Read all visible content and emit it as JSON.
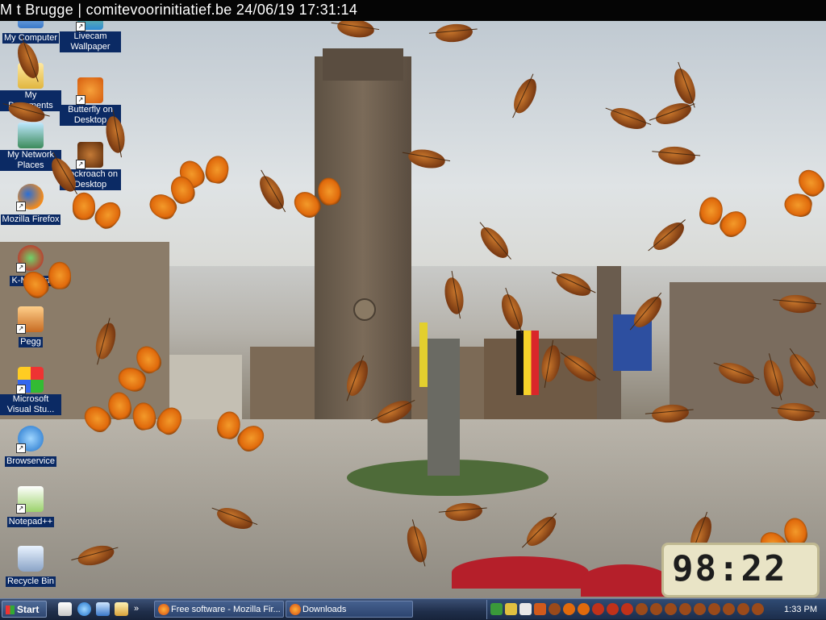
{
  "window_title": "M    t Brugge | comitevoorinitiatief.be 24/06/19 17:31:14",
  "desktop_icons": [
    {
      "label": "My Computer",
      "icon": "computer-icon"
    },
    {
      "label": "Livecam Wallpaper",
      "icon": "livecam-icon"
    },
    {
      "label": "My Documents",
      "icon": "folder-icon"
    },
    {
      "label": "Butterfly on Desktop",
      "icon": "butterfly-icon"
    },
    {
      "label": "My Network Places",
      "icon": "network-icon"
    },
    {
      "label": "Cockroach on Desktop",
      "icon": "cockroach-icon"
    },
    {
      "label": "Mozilla Firefox",
      "icon": "firefox-icon"
    },
    {
      "label": "K-Meleon",
      "icon": "kmeleon-icon"
    },
    {
      "label": "Pegg",
      "icon": "pegg-icon"
    },
    {
      "label": "Microsoft Visual Stu...",
      "icon": "visual-studio-icon"
    },
    {
      "label": "Browservice",
      "icon": "browser-icon"
    },
    {
      "label": "Notepad++",
      "icon": "notepad-icon"
    },
    {
      "label": "Recycle Bin",
      "icon": "recycle-bin-icon"
    }
  ],
  "clock_widget": "98:22",
  "taskbar": {
    "start_label": "Start",
    "tasks": [
      {
        "label": "Free software - Mozilla Fir...",
        "icon": "firefox-icon"
      },
      {
        "label": "Downloads",
        "icon": "downloads-icon"
      }
    ],
    "time": "1:33 PM"
  },
  "colors": {
    "taskbar": "#1f2e4a",
    "icon_label_bg": "#0b2a64",
    "butterfly": "#e06a0c",
    "cockroach": "#7a3a12"
  }
}
